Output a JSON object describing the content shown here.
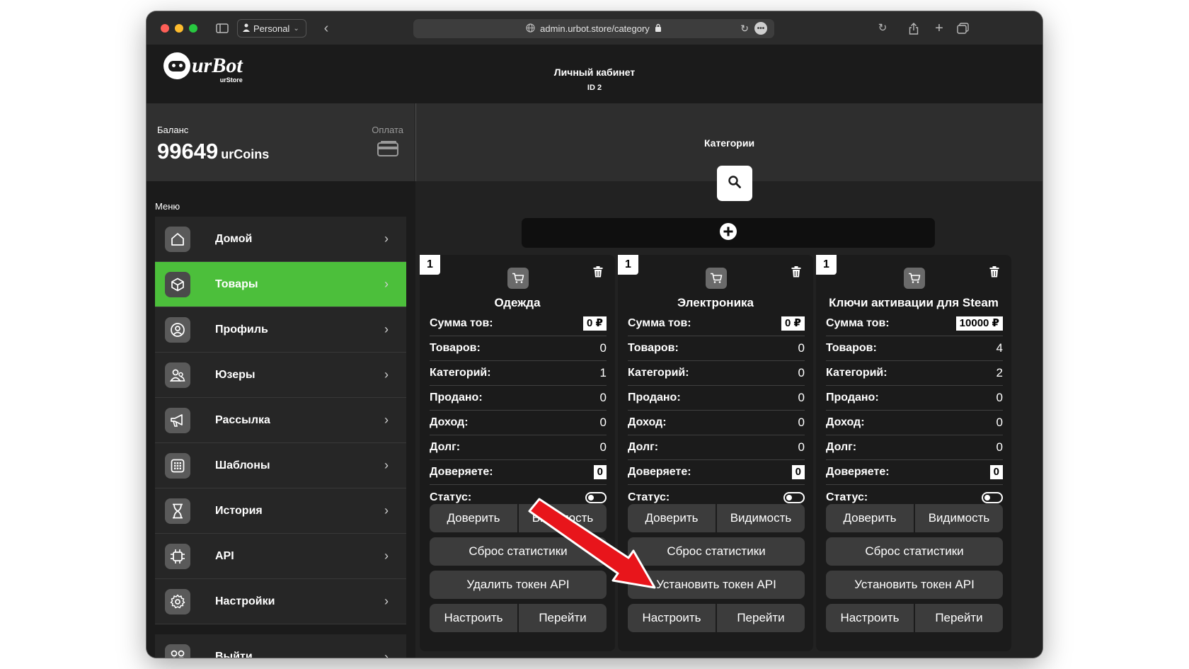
{
  "browser": {
    "profile": "Personal",
    "url": "admin.urbot.store/category"
  },
  "header": {
    "logo_text": "urBot",
    "logo_sub": "urStore",
    "title": "Личный кабинет",
    "id_label": "ID 2"
  },
  "balance": {
    "label": "Баланс",
    "value": "99649",
    "unit": "urCoins",
    "pay_label": "Оплата"
  },
  "menu": {
    "label": "Меню",
    "items": [
      {
        "label": "Домой",
        "icon": "home-icon"
      },
      {
        "label": "Товары",
        "icon": "box-icon",
        "active": true
      },
      {
        "label": "Профиль",
        "icon": "profile-icon"
      },
      {
        "label": "Юзеры",
        "icon": "users-icon"
      },
      {
        "label": "Рассылка",
        "icon": "megaphone-icon"
      },
      {
        "label": "Шаблоны",
        "icon": "grid-icon"
      },
      {
        "label": "История",
        "icon": "hourglass-icon"
      },
      {
        "label": "API",
        "icon": "chip-icon"
      },
      {
        "label": "Настройки",
        "icon": "gear-icon"
      }
    ],
    "exit": {
      "label": "Выйти",
      "icon": "exit-icon"
    }
  },
  "main": {
    "title": "Категории"
  },
  "stat_labels": {
    "sum": "Сумма тов:",
    "goods": "Товаров:",
    "cats": "Категорий:",
    "sold": "Продано:",
    "income": "Доход:",
    "debt": "Долг:",
    "trust": "Доверяете:",
    "status": "Статус:"
  },
  "buttons": {
    "trust": "Доверить",
    "visibility": "Видимость",
    "reset": "Сброс статистики",
    "configure": "Настроить",
    "open": "Перейти"
  },
  "cards": [
    {
      "num": "1",
      "title": "Одежда",
      "sum": "0 ₽",
      "goods": "0",
      "cats": "1",
      "sold": "0",
      "income": "0",
      "debt": "0",
      "trust": "0",
      "token_btn": "Удалить токен API"
    },
    {
      "num": "1",
      "title": "Электроника",
      "sum": "0 ₽",
      "goods": "0",
      "cats": "0",
      "sold": "0",
      "income": "0",
      "debt": "0",
      "trust": "0",
      "token_btn": "Установить токен API"
    },
    {
      "num": "1",
      "title": "Ключи активации для Steam",
      "sum": "10000 ₽",
      "goods": "4",
      "cats": "2",
      "sold": "0",
      "income": "0",
      "debt": "0",
      "trust": "0",
      "token_btn": "Установить токен API"
    }
  ],
  "colors": {
    "accent_green": "#4cbf3b",
    "arrow_red": "#e8151b"
  }
}
